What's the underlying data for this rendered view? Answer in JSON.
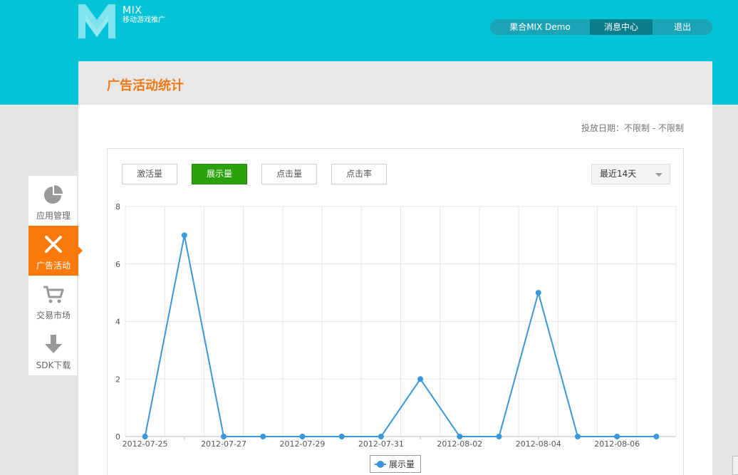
{
  "header": {
    "logo_name": "MIX",
    "logo_tagline": "移动游戏推广",
    "nav": [
      {
        "label": "果合MIX Demo"
      },
      {
        "label": "消息中心"
      },
      {
        "label": "退出"
      }
    ]
  },
  "sidebar": {
    "items": [
      {
        "label": "应用管理",
        "icon": "pie-chart-icon"
      },
      {
        "label": "广告活动",
        "icon": "crossed-tools-icon",
        "active": true
      },
      {
        "label": "交易市场",
        "icon": "shopping-cart-icon"
      },
      {
        "label": "SDK下载",
        "icon": "download-arrow-icon"
      }
    ]
  },
  "page": {
    "title": "广告活动统计",
    "date_range_label": "投放日期：不限制 - 不限制"
  },
  "controls": {
    "metrics": [
      {
        "label": "激活量"
      },
      {
        "label": "展示量",
        "active": true
      },
      {
        "label": "点击量"
      },
      {
        "label": "点击率"
      }
    ],
    "range_select": "最近14天"
  },
  "colors": {
    "brand_cyan": "#03c3d6",
    "accent_orange": "#f97a0a",
    "title_orange": "#f07b14",
    "active_green": "#2ba10e",
    "series_blue": "#3a97db"
  },
  "chart_data": {
    "type": "line",
    "x": [
      "2012-07-25",
      "2012-07-26",
      "2012-07-27",
      "2012-07-28",
      "2012-07-29",
      "2012-07-30",
      "2012-07-31",
      "2012-08-01",
      "2012-08-02",
      "2012-08-03",
      "2012-08-04",
      "2012-08-05",
      "2012-08-06",
      "2012-08-07"
    ],
    "x_tick_labels": [
      "2012-07-25",
      "2012-07-27",
      "2012-07-29",
      "2012-07-31",
      "2012-08-02",
      "2012-08-04",
      "2012-08-06"
    ],
    "series": [
      {
        "name": "展示量",
        "values": [
          0,
          7,
          0,
          0,
          0,
          0,
          0,
          2,
          0,
          0,
          5,
          0,
          0,
          0
        ]
      }
    ],
    "ylim": [
      0,
      8
    ],
    "y_ticks": [
      0,
      2,
      4,
      6,
      8
    ],
    "grid": true,
    "legend": "bottom-center"
  }
}
